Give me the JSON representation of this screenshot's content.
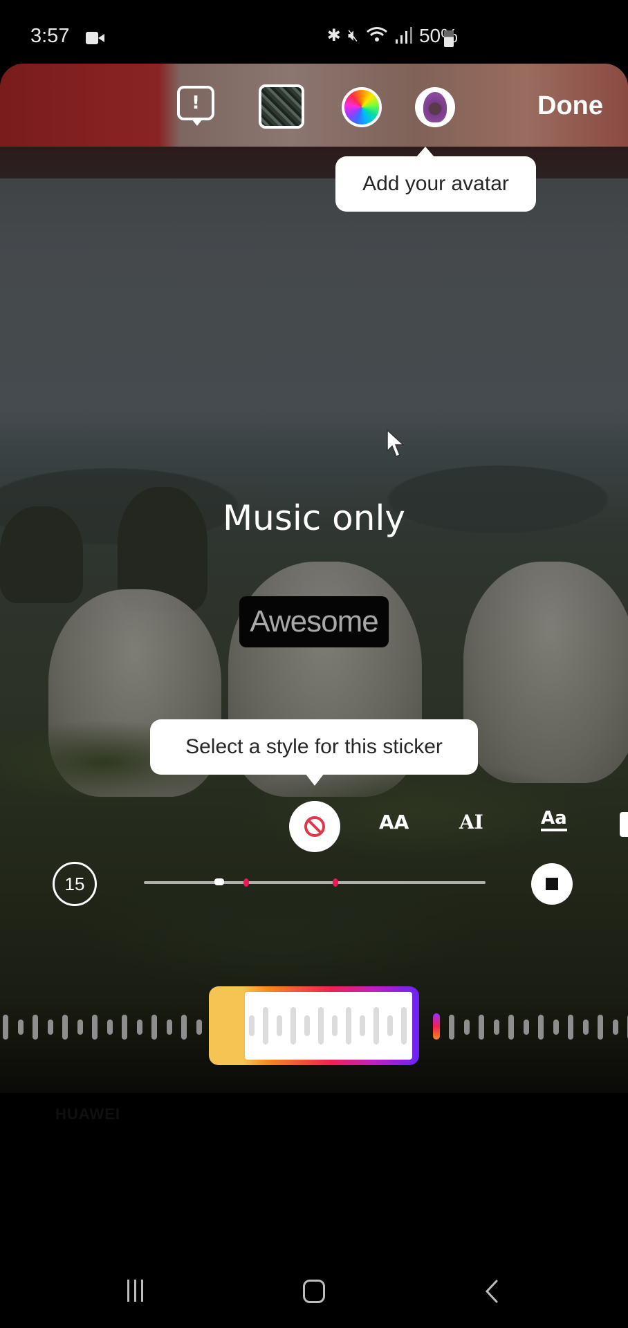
{
  "status_bar": {
    "time": "3:57",
    "icons": [
      "video-record-icon",
      "bluetooth-icon",
      "mute-icon",
      "wifi-icon",
      "signal-icon",
      "battery-icon"
    ],
    "battery": "50%"
  },
  "toolbar": {
    "buttons": [
      "report-icon",
      "gallery-thumbnail",
      "color-wheel",
      "avatar"
    ],
    "done_label": "Done"
  },
  "tooltips": {
    "avatar": "Add your avatar",
    "style": "Select a style for this sticker"
  },
  "canvas": {
    "music_label": "Music only",
    "sticker_text": "Awesome"
  },
  "style_picker": {
    "options": [
      {
        "name": "none",
        "glyph": "⦸"
      },
      {
        "name": "classic",
        "glyph": "AA"
      },
      {
        "name": "typewriter",
        "glyph": "AI"
      },
      {
        "name": "underline",
        "glyph": "Aa"
      },
      {
        "name": "boxed",
        "glyph": "A"
      }
    ],
    "selected": "none",
    "none_color": "#e0384b"
  },
  "music_timeline": {
    "duration_seconds": "15",
    "playhead_position": 0.22,
    "markers": [
      0.3,
      0.56
    ],
    "marker_color": "#e8185a",
    "clip_gradient": [
      "#f6c453",
      "#f58a1c",
      "#f41f52",
      "#c11fbf",
      "#6a24f6"
    ]
  },
  "watermark": "HUAWEI",
  "navbar": {
    "buttons": [
      "recents-icon",
      "home-icon",
      "back-icon"
    ]
  }
}
